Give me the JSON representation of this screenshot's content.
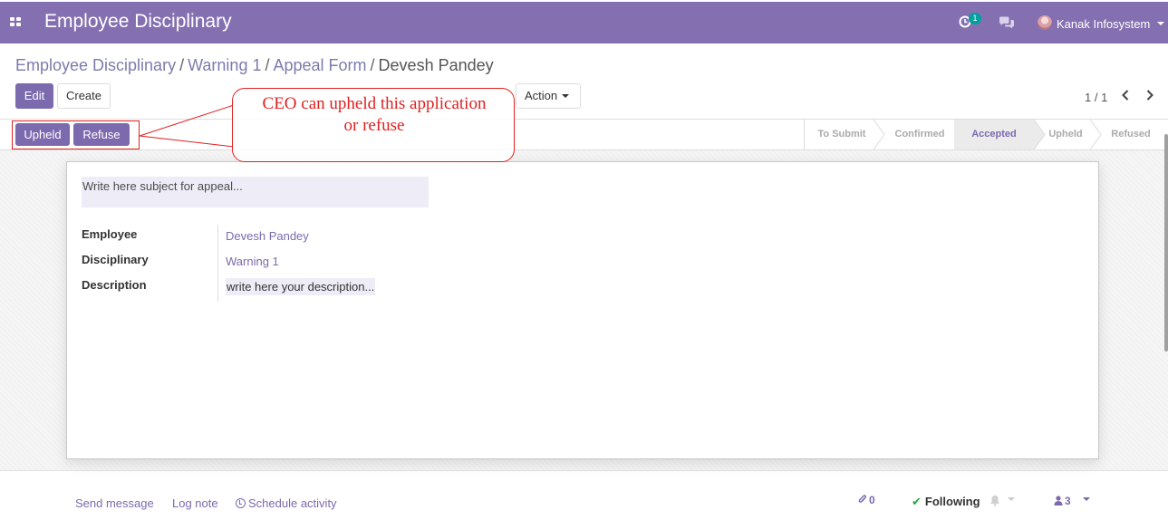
{
  "navbar": {
    "app_title": "Employee Disciplinary",
    "activity_count": "1",
    "user_name": "Kanak Infosystem"
  },
  "breadcrumb": {
    "items": [
      "Employee Disciplinary",
      "Warning 1",
      "Appeal Form"
    ],
    "separator": "/",
    "current": "Devesh Pandey"
  },
  "toolbar": {
    "edit_label": "Edit",
    "create_label": "Create",
    "action_label": "Action"
  },
  "pager": {
    "value": "1 / 1"
  },
  "header_buttons": {
    "upheld_label": "Upheld",
    "refuse_label": "Refuse"
  },
  "statusbar": {
    "steps": [
      "To Submit",
      "Confirmed",
      "Accepted",
      "Upheld",
      "Refused"
    ],
    "current": "Accepted"
  },
  "form": {
    "subject_placeholder": "Write here subject for appeal...",
    "fields": [
      {
        "label": "Employee",
        "value": "Devesh Pandey"
      },
      {
        "label": "Disciplinary",
        "value": "Warning 1"
      },
      {
        "label": "Description",
        "value": "write here your description..."
      }
    ]
  },
  "chatter": {
    "send_message": "Send message",
    "log_note": "Log note",
    "schedule_activity": "Schedule activity",
    "attachments_count": "0",
    "following_label": "Following",
    "followers_count": "3"
  },
  "annotation": {
    "line1": "CEO can upheld this application",
    "line2": "or refuse"
  },
  "colors": {
    "brand": "#8470b0",
    "primary": "#7c6aae",
    "annotation_red": "#e02020"
  }
}
